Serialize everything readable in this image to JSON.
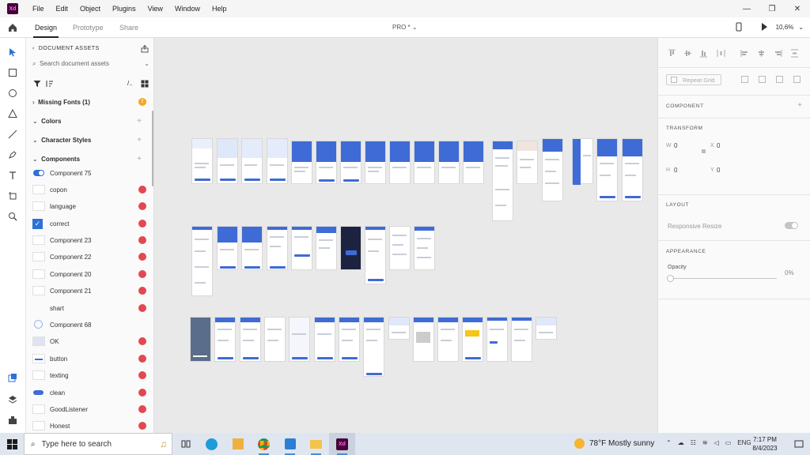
{
  "titlebar": {
    "menu": [
      "File",
      "Edit",
      "Object",
      "Plugins",
      "View",
      "Window",
      "Help"
    ],
    "logo_text": "Xd"
  },
  "modebar": {
    "tabs": [
      "Design",
      "Prototype",
      "Share"
    ],
    "doc_title": "PRO *",
    "zoom": "10,6%"
  },
  "assets": {
    "header": "DOCUMENT ASSETS",
    "search_placeholder": "Search document assets",
    "missing_fonts": "Missing Fonts (1)",
    "colors": "Colors",
    "character_styles": "Character Styles",
    "components": "Components",
    "component_items": [
      "Component 75",
      "copon",
      "language",
      "correct",
      "Component 23",
      "Component 22",
      "Component 20",
      "Component 21",
      "shart",
      "Component 68",
      "OK",
      "button",
      "texting",
      "clean",
      "GoodListener",
      "Honest"
    ]
  },
  "properties": {
    "repeat_grid": "Repeat Grid",
    "component": "COMPONENT",
    "transform": "TRANSFORM",
    "w_label": "W",
    "w_value": "0",
    "x_label": "X",
    "x_value": "0",
    "h_label": "H",
    "h_value": "0",
    "y_label": "Y",
    "y_value": "0",
    "layout": "LAYOUT",
    "responsive_resize": "Responsive Resize",
    "appearance": "APPEARANCE",
    "opacity": "Opacity",
    "opacity_value": "0%"
  },
  "taskbar": {
    "search_placeholder": "Type here to search",
    "weather": "78°F  Mostly sunny",
    "lang": "ENG",
    "time": "7:17 PM",
    "date": "8/4/2023"
  },
  "colors": {
    "accent": "#3f6bd6",
    "xd_bg": "#470137",
    "xd_fg": "#ff61f6",
    "warning": "#f5a623",
    "error": "#e34850"
  }
}
